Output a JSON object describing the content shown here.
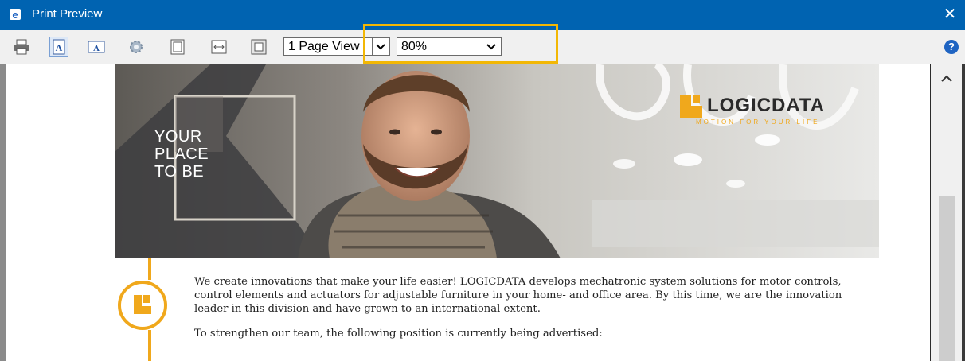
{
  "window": {
    "title": "Print Preview",
    "close_glyph": "✕",
    "icon": "print-preview-icon"
  },
  "toolbar": {
    "buttons": [
      {
        "name": "print-icon"
      },
      {
        "name": "portrait-icon",
        "active": true
      },
      {
        "name": "landscape-icon"
      },
      {
        "name": "page-setup-icon"
      },
      {
        "name": "full-page-icon"
      },
      {
        "name": "page-width-icon"
      },
      {
        "name": "shrink-to-fit-icon"
      }
    ],
    "view_select": {
      "value": "1 Page View"
    },
    "zoom_select": {
      "value": "80%"
    },
    "help_glyph": "?"
  },
  "banner": {
    "headline_lines": [
      "YOUR",
      "PLACE",
      "TO BE"
    ],
    "brand_name": "LOGICDATA",
    "brand_tagline": "MOTION FOR YOUR LIFE"
  },
  "content": {
    "paragraph1_lines": [
      "We create innovations that make your life easier! LOGICDATA develops mechatronic system solutions for motor controls,",
      "control elements and actuators for adjustable furniture in your home- and office area. By this time, we are the innovation",
      "leader in this division and have grown to an international extent."
    ],
    "paragraph2": "To strengthen our team, the following position is currently being advertised:"
  },
  "colors": {
    "titlebar": "#0063b1",
    "highlight": "#f2b705",
    "brand_orange": "#f0a81c"
  }
}
